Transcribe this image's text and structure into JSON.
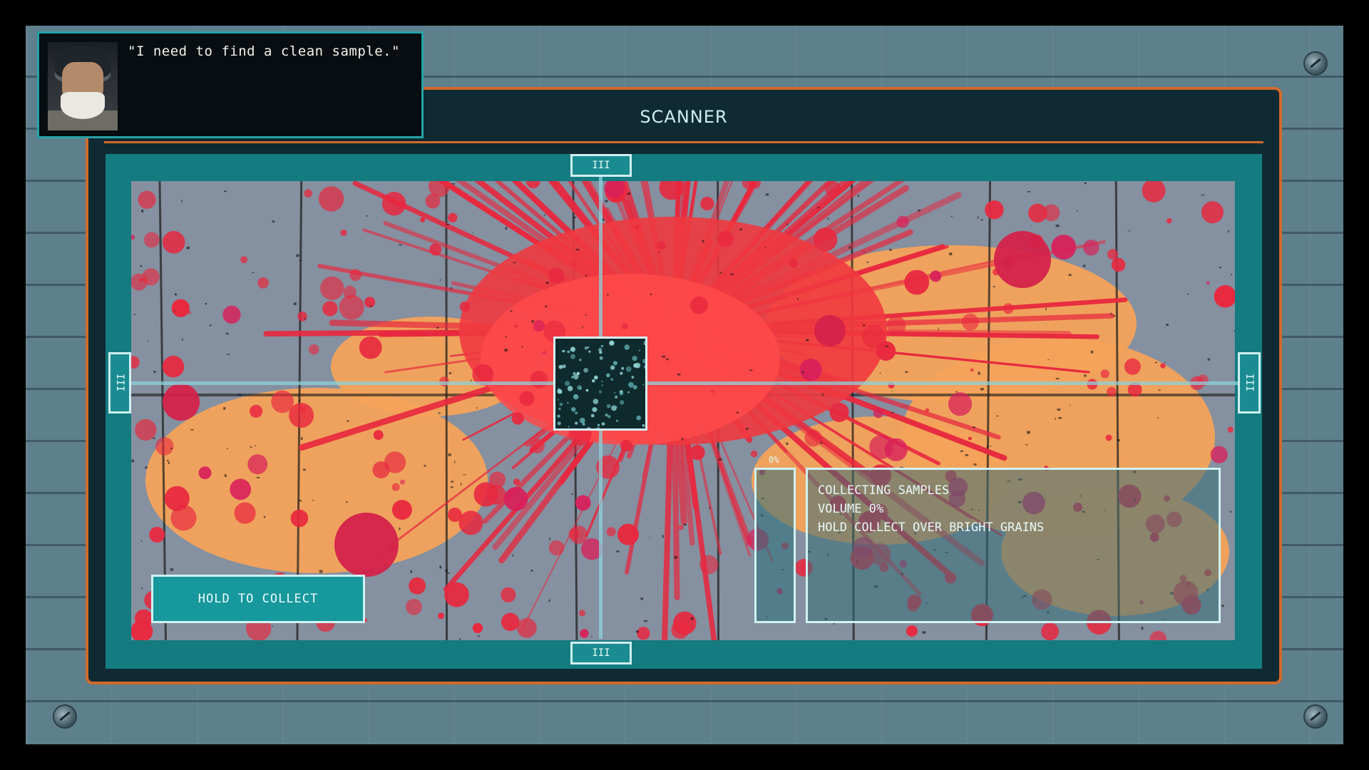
{
  "dialog": {
    "speaker_portrait": "bearded-detective-portrait",
    "text": "\"I need to find a clean sample.\""
  },
  "scanner": {
    "title": "SCANNER",
    "handles": {
      "top": "III",
      "bottom": "III",
      "left": "III",
      "right": "III"
    },
    "collect_button": "HOLD TO COLLECT",
    "meter": {
      "label": "0%",
      "fill_fraction": 0
    },
    "info": {
      "line1": "COLLECTING SAMPLES",
      "line2": "VOLUME  0%",
      "line3": "HOLD COLLECT OVER BRIGHT GRAINS"
    }
  },
  "colors": {
    "frame_accent": "#d16a2a",
    "teal": "#147b80",
    "blood": "#e8283f",
    "stain_orange": "#f4a35a"
  }
}
